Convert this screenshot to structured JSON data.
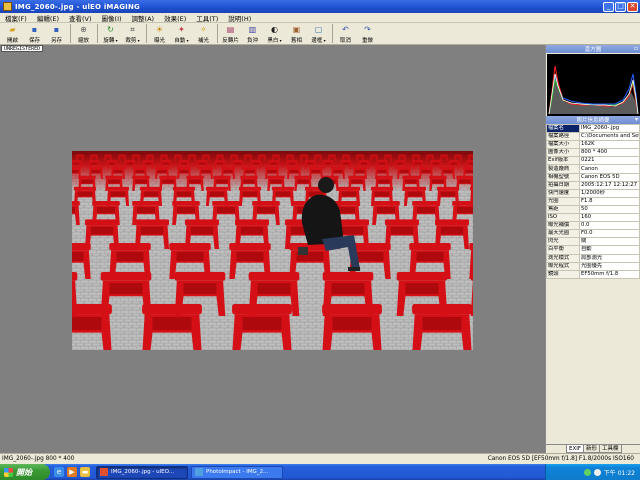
{
  "window": {
    "title": "IMG_2060-.jpg - ulEO iMAGING"
  },
  "menu": [
    "檔案(F)",
    "編輯(E)",
    "查看(V)",
    "圖像(I)",
    "調整(A)",
    "效果(E)",
    "工具(T)",
    "說明(H)"
  ],
  "toolbar": [
    {
      "label": "開啟",
      "icon": "open-folder-icon",
      "color": "#d8a020",
      "glyph": "▰"
    },
    {
      "label": "保存",
      "icon": "save-disk-icon",
      "color": "#3060c0",
      "glyph": "▪"
    },
    {
      "label": "另存",
      "icon": "save-as-icon",
      "color": "#3060c0",
      "glyph": "▪"
    },
    {
      "label": "縮放",
      "icon": "zoom-icon",
      "color": "#606060",
      "glyph": "⊕"
    },
    {
      "label": "旋轉",
      "icon": "rotate-icon",
      "color": "#2a8a2a",
      "glyph": "↻",
      "dropdown": true
    },
    {
      "label": "裁剪",
      "icon": "crop-icon",
      "color": "#404040",
      "glyph": "⌗",
      "dropdown": true
    },
    {
      "label": "曝光",
      "icon": "exposure-icon",
      "color": "#c08000",
      "glyph": "☀"
    },
    {
      "label": "自動",
      "icon": "auto-icon",
      "color": "#c04040",
      "glyph": "✦",
      "dropdown": true
    },
    {
      "label": "補光",
      "icon": "fill-light-icon",
      "color": "#d0a000",
      "glyph": "✧"
    },
    {
      "label": "反轉片",
      "icon": "slide-film-icon",
      "color": "#a03060",
      "glyph": "▤"
    },
    {
      "label": "負沖",
      "icon": "cross-process-icon",
      "color": "#4040a0",
      "glyph": "▥"
    },
    {
      "label": "黑白",
      "icon": "black-white-icon",
      "color": "#202020",
      "glyph": "◐",
      "dropdown": true
    },
    {
      "label": "舊相",
      "icon": "old-photo-icon",
      "color": "#a06030",
      "glyph": "▣"
    },
    {
      "label": "邊框",
      "icon": "frame-icon",
      "color": "#3070b0",
      "glyph": "▢",
      "dropdown": true
    },
    {
      "label": "取消",
      "icon": "undo-icon",
      "color": "#3050b0",
      "glyph": "↶"
    },
    {
      "label": "重做",
      "icon": "redo-icon",
      "color": "#3050b0",
      "glyph": "↷"
    }
  ],
  "canvas": {
    "tag": "UNREGISTERED"
  },
  "panel": {
    "histogram_title": "直方圖",
    "info_title": "照片信息摘要",
    "rows": [
      {
        "k": "檔案名",
        "v": "IMG_2060-.jpg"
      },
      {
        "k": "檔案路徑",
        "v": "C:\\Documents and Setting"
      },
      {
        "k": "檔案大小",
        "v": "162K"
      },
      {
        "k": "圖像大小",
        "v": "800 * 400"
      },
      {
        "k": "Exif版本",
        "v": "0221"
      },
      {
        "k": "製造廠商",
        "v": "Canon"
      },
      {
        "k": "相機型號",
        "v": "Canon EOS 5D"
      },
      {
        "k": "拍攝日期",
        "v": "2005:12:17 12:12:27"
      },
      {
        "k": "快門速度",
        "v": "1/2000秒"
      },
      {
        "k": "光圈",
        "v": "F1.8"
      },
      {
        "k": "焦距",
        "v": "50"
      },
      {
        "k": "ISO",
        "v": "160"
      },
      {
        "k": "曝光補償",
        "v": "0.0"
      },
      {
        "k": "最大光圈",
        "v": "F0.0"
      },
      {
        "k": "閃光",
        "v": "關"
      },
      {
        "k": "白平衡",
        "v": "自動"
      },
      {
        "k": "測光模式",
        "v": "局部測光"
      },
      {
        "k": "曝光程式",
        "v": "光圈優先"
      },
      {
        "k": "鏡頭",
        "v": "EF50mm f/1.8"
      }
    ],
    "tabs": [
      "EXIF",
      "新形",
      "工具欄"
    ]
  },
  "status": {
    "left": "IMG_2060-.jpg  800 * 400",
    "right": "Canon EOS 5D  [EF50mm f/1.8]  F1.8/2000s  ISO160"
  },
  "taskbar": {
    "start": "開始",
    "tasks": [
      {
        "label": "IMG_2060-.jpg - ulEO...",
        "active": true,
        "color": "#e05030"
      },
      {
        "label": "PhotoImpact - IMG_2...",
        "active": false,
        "color": "#50a0e0"
      }
    ],
    "clock": "下午 01:22"
  },
  "colors": {
    "chair": "#d41016",
    "chair_dark": "#8e060a",
    "pavement": "#b8b8b8"
  }
}
